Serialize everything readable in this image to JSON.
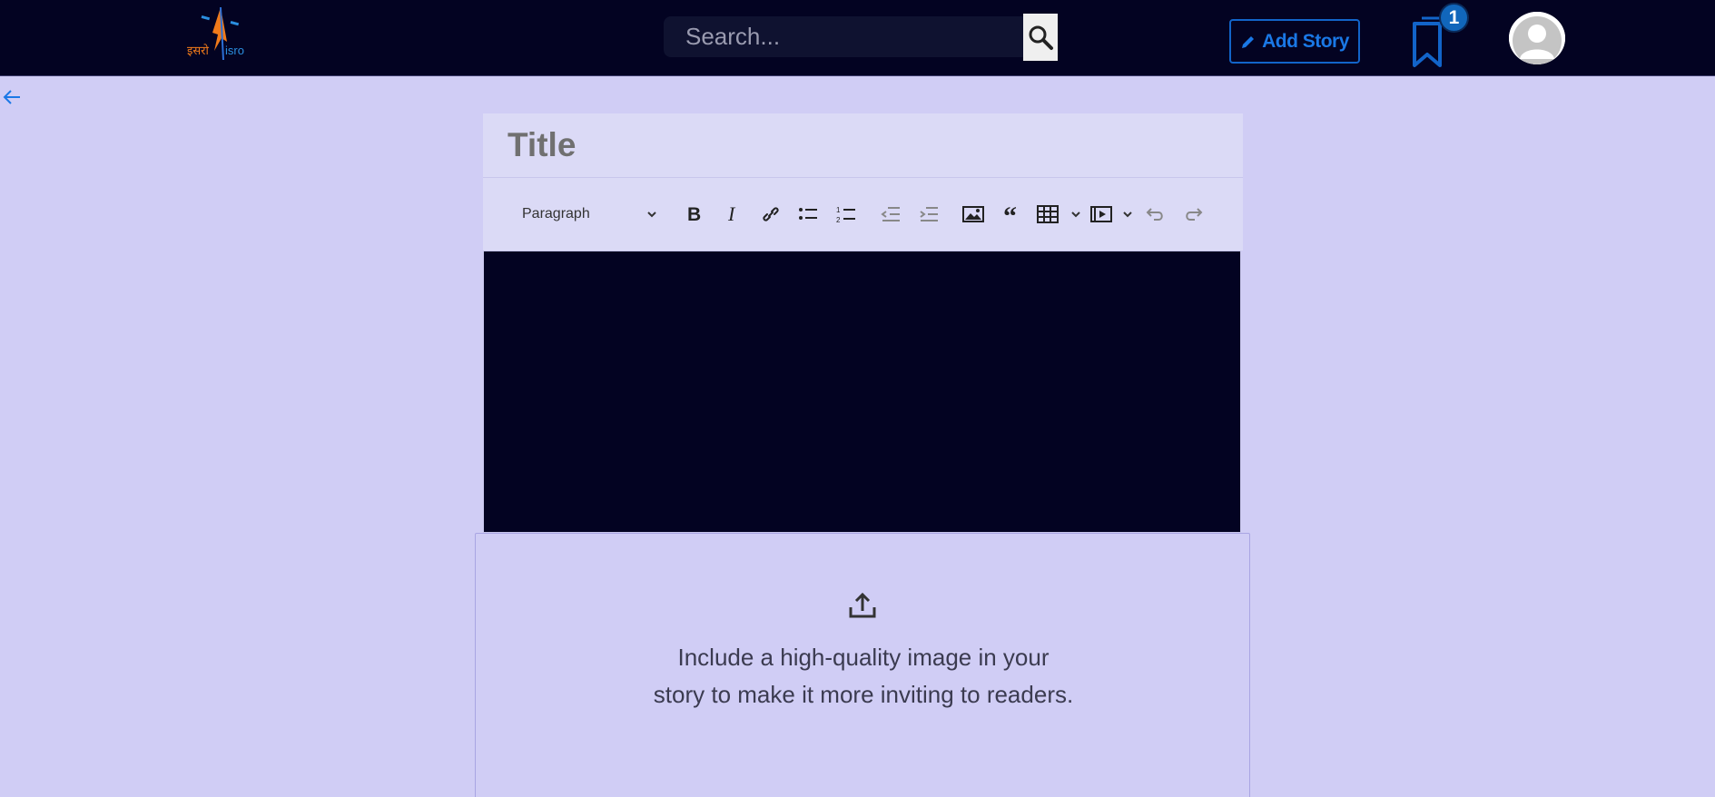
{
  "header": {
    "logo_text": "इसरो isro",
    "search": {
      "placeholder": "Search...",
      "value": ""
    },
    "add_story_label": "Add Story",
    "bookmark_count": "1"
  },
  "editor": {
    "title_placeholder": "Title",
    "block_format": "Paragraph",
    "toolbar_icons": [
      "bold-icon",
      "italic-icon",
      "link-icon",
      "bulleted-list-icon",
      "numbered-list-icon",
      "outdent-icon",
      "indent-icon",
      "insert-image-icon",
      "block-quote-icon",
      "insert-table-icon",
      "insert-media-icon",
      "undo-icon",
      "redo-icon"
    ]
  },
  "upload": {
    "text": "Include a high-quality image in your story to make it more inviting to readers."
  },
  "colors": {
    "header_bg": "#030322",
    "page_bg": "#d0cdf5",
    "accent": "#1a78e6",
    "editor_bg": "#030322"
  }
}
